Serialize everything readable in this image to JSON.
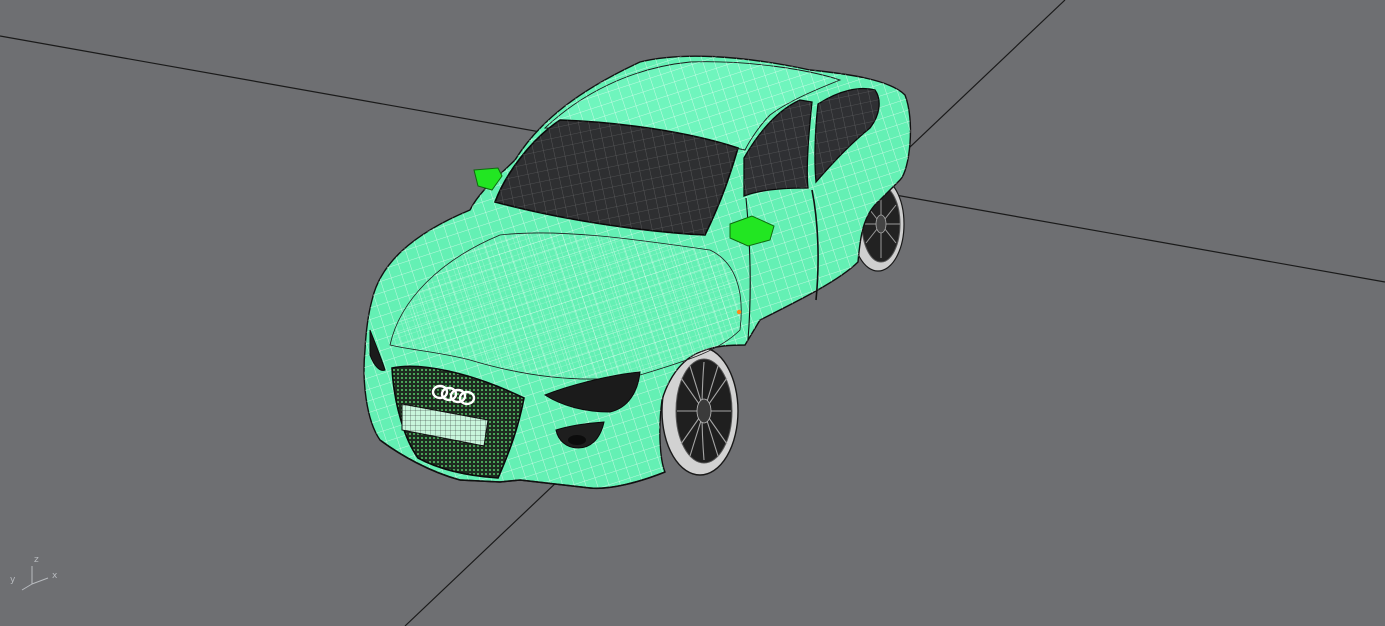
{
  "viewport": {
    "projection": "perspective",
    "background_color": "#6e6f72",
    "grid_axis_color": "#1a1a1a"
  },
  "model": {
    "display_mode": "wireframe-shaded",
    "body_color": "#64f0b4",
    "wire_color": "#ffffff",
    "glass_color": "#2e2f31",
    "selected_color": "#22e622",
    "tire_color": "#1c1c1c",
    "rim_color": "#c8c8c8"
  },
  "axis_widget": {
    "z_label": "z",
    "y_label": "y",
    "x_label": "x",
    "color": "#b8bbbf"
  }
}
